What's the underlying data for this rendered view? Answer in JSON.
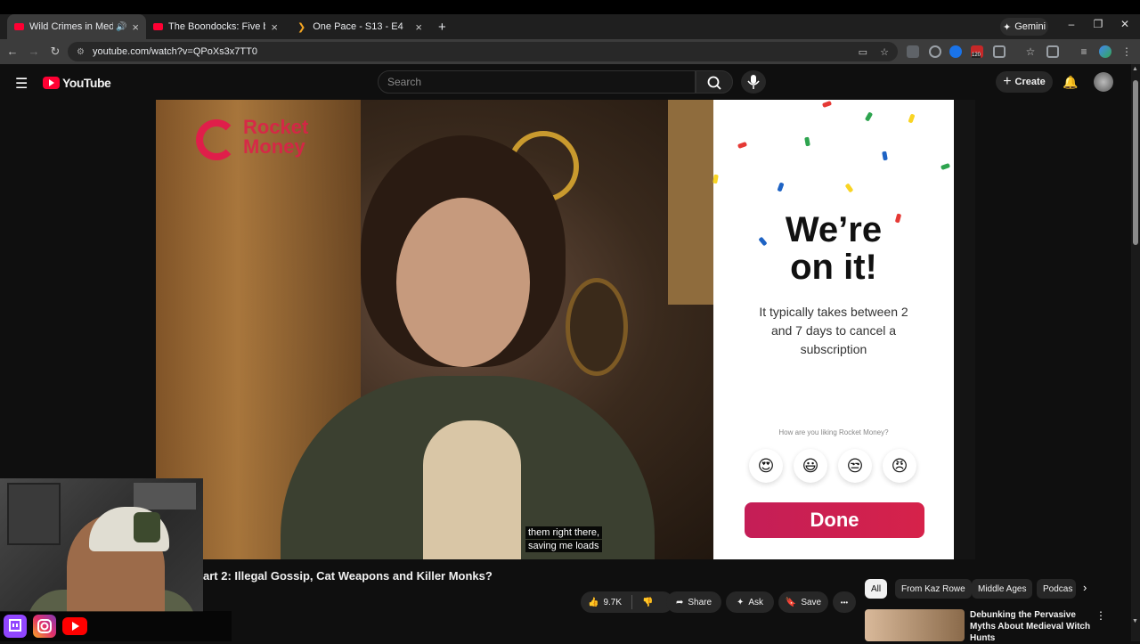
{
  "browser": {
    "tabs": [
      {
        "title": "Wild Crimes in Medieval Ti",
        "active": true,
        "favicon_color": "#ff0033"
      },
      {
        "title": "The Boondocks: Five black f",
        "active": false,
        "favicon_color": "#ff0033"
      },
      {
        "title": "One Pace - S13 - E4",
        "active": false,
        "favicon_color": "#f5a623"
      }
    ],
    "new_tab": "+",
    "gemini_label": "Gemini",
    "url": "youtube.com/watch?v=QPoXs3x7TT0",
    "ext_badge": "120"
  },
  "youtube": {
    "logo_text": "YouTube",
    "search_placeholder": "Search",
    "create_label": "Create"
  },
  "video": {
    "brand_line1": "Rocket",
    "brand_line2": "Money",
    "subtitle_line1": "them right there,",
    "subtitle_line2": "saving me loads",
    "title": "art 2: Illegal Gossip, Cat Weapons and Killer Monks?"
  },
  "ad_panel": {
    "headline_line1": "We’re",
    "headline_line2": "on it!",
    "body": "It typically takes between 2 and 7 days to cancel a subscription",
    "question": "How are you liking Rocket Money?",
    "emojis": [
      "😍",
      "😃",
      "😒",
      "😠"
    ],
    "done_label": "Done"
  },
  "actions": {
    "likes": "9.7K",
    "share": "Share",
    "ask": "Ask",
    "save": "Save",
    "more": "•••"
  },
  "chips": [
    "All",
    "From Kaz Rowe",
    "Middle Ages",
    "Podcas"
  ],
  "related": {
    "title": "Debunking the Pervasive Myths About Medieval Witch Hunts"
  },
  "colors": {
    "accent_red": "#ff0033",
    "rocket_red": "#e01e4a",
    "done_button": "#c41e57"
  }
}
